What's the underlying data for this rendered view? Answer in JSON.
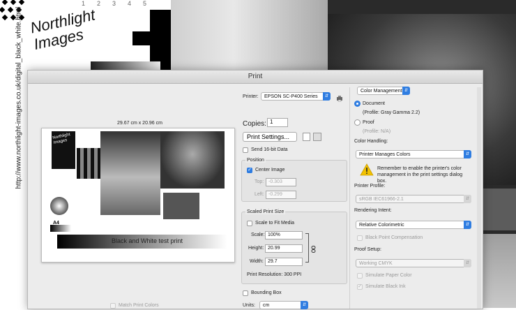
{
  "background": {
    "url_text": "http://www.northlight-images.co.uk/digital_black_white.html",
    "numbers": [
      "1",
      "2",
      "3",
      "4",
      "5"
    ],
    "logo_text": "Northlight Images"
  },
  "dialog": {
    "title": "Print",
    "printer_label": "Printer:",
    "printer_value": "EPSON SC-P400 Series",
    "copies_label": "Copies:",
    "copies_value": "1",
    "print_settings_button": "Print Settings...",
    "send16_label": "Send 16-bit Data",
    "position": {
      "title": "Position",
      "center_label": "Center Image",
      "top_label": "Top:",
      "top_value": "-0.303",
      "left_label": "Left:",
      "left_value": "-0.299"
    },
    "scaled": {
      "title": "Scaled Print Size",
      "scale_to_fit": "Scale to Fit Media",
      "scale_label": "Scale:",
      "scale_value": "100%",
      "height_label": "Height:",
      "height_value": "20.99",
      "width_label": "Width:",
      "width_value": "29.7",
      "resolution": "Print Resolution: 300 PPI"
    },
    "bounding_box_label": "Bounding Box",
    "units_label": "Units:",
    "units_value": "cm",
    "preview": {
      "size_text": "29.67 cm x 20.96 cm",
      "caption": "Black and White test print",
      "a4_label": "A4",
      "logo": "Northlight Images"
    },
    "match_print_colors": "Match Print Colors",
    "color_management": {
      "menu_value": "Color Management",
      "document_label": "Document",
      "document_profile": "(Profile: Gray Gamma 2.2)",
      "proof_label": "Proof",
      "proof_profile": "(Profile: N/A)",
      "color_handling_label": "Color Handling:",
      "color_handling_value": "Printer Manages Colors",
      "warning_text": "Remember to enable the printer's color management in the print settings dialog box.",
      "printer_profile_label": "Printer Profile:",
      "printer_profile_value": "sRGB IEC61966-2.1",
      "rendering_intent_label": "Rendering Intent:",
      "rendering_intent_value": "Relative Colorimetric",
      "black_point_label": "Black Point Compensation",
      "proof_setup_label": "Proof Setup:",
      "proof_setup_value": "Working CMYK",
      "simulate_paper_label": "Simulate Paper Color",
      "simulate_ink_label": "Simulate Black Ink"
    }
  },
  "colors": {
    "accent": "#2f7de1",
    "warning": "#f2c200"
  }
}
